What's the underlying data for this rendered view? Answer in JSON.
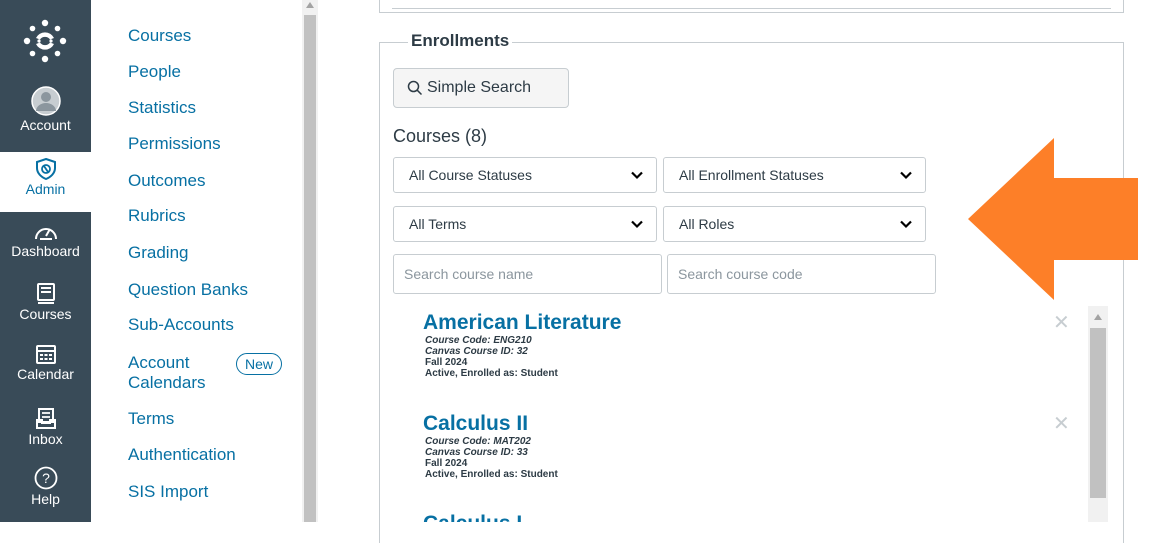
{
  "global_nav": {
    "items": [
      {
        "label": "Account",
        "icon": "account-avatar-icon"
      },
      {
        "label": "Admin",
        "icon": "admin-shield-icon"
      },
      {
        "label": "Dashboard",
        "icon": "dashboard-icon"
      },
      {
        "label": "Courses",
        "icon": "courses-book-icon"
      },
      {
        "label": "Calendar",
        "icon": "calendar-icon"
      },
      {
        "label": "Inbox",
        "icon": "inbox-icon"
      },
      {
        "label": "Help",
        "icon": "help-icon"
      }
    ],
    "active": "Admin",
    "bg_color": "#394b58"
  },
  "sub_nav": {
    "items": [
      {
        "label": "Courses"
      },
      {
        "label": "People"
      },
      {
        "label": "Statistics"
      },
      {
        "label": "Permissions"
      },
      {
        "label": "Outcomes"
      },
      {
        "label": "Rubrics"
      },
      {
        "label": "Grading"
      },
      {
        "label": "Question Banks"
      },
      {
        "label": "Sub-Accounts"
      },
      {
        "label": "Account Calendars",
        "line1": "Account",
        "line2": "Calendars",
        "badge": "New"
      },
      {
        "label": "Terms"
      },
      {
        "label": "Authentication"
      },
      {
        "label": "SIS Import"
      }
    ],
    "link_color": "#0770a3"
  },
  "enrollments": {
    "legend": "Enrollments",
    "simple_search_label": "Simple Search",
    "courses_heading": "Courses (8)",
    "filters": {
      "course_status": "All Course Statuses",
      "enrollment_status": "All Enrollment Statuses",
      "term": "All Terms",
      "role": "All Roles"
    },
    "search": {
      "name_placeholder": "Search course name",
      "code_placeholder": "Search course code"
    },
    "courses": [
      {
        "title": "American Literature",
        "code": "Course Code: ENG210",
        "canvas_id": "Canvas Course ID: 32",
        "term": "Fall 2024",
        "status": "Active, Enrolled as: Student"
      },
      {
        "title": "Calculus II",
        "code": "Course Code: MAT202",
        "canvas_id": "Canvas Course ID: 33",
        "term": "Fall 2024",
        "status": "Active, Enrolled as: Student"
      },
      {
        "title": "Calculus I"
      }
    ]
  },
  "annotation": {
    "arrow_color": "#fd7f28",
    "arrow_direction": "left"
  }
}
